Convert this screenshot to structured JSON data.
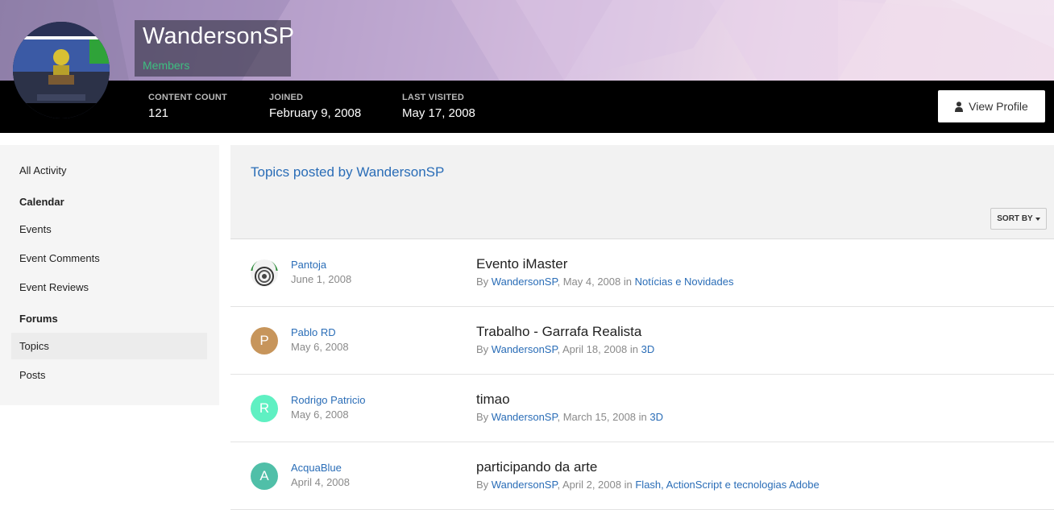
{
  "profile": {
    "username": "WandersonSP",
    "group": "Members",
    "stats": [
      {
        "label": "CONTENT COUNT",
        "value": "121"
      },
      {
        "label": "JOINED",
        "value": "February 9, 2008"
      },
      {
        "label": "LAST VISITED",
        "value": "May 17, 2008"
      }
    ],
    "view_profile_label": "View Profile"
  },
  "sidebar": {
    "all_activity": "All Activity",
    "calendar_heading": "Calendar",
    "calendar_items": [
      "Events",
      "Event Comments",
      "Event Reviews"
    ],
    "forums_heading": "Forums",
    "forums_items": [
      "Topics",
      "Posts"
    ]
  },
  "main": {
    "title": "Topics posted by WandersonSP",
    "sort_label": "SORT BY",
    "by_label": "By",
    "in_label": "in",
    "topics": [
      {
        "poster": "Pantoja",
        "poster_date": "June 1, 2008",
        "avatar_letter": "",
        "avatar_color": "#ffffff",
        "title": "Evento iMaster",
        "author": "WandersonSP",
        "date": "May 4, 2008",
        "forum": "Notícias e Novidades"
      },
      {
        "poster": "Pablo RD",
        "poster_date": "May 6, 2008",
        "avatar_letter": "P",
        "avatar_color": "#c7955b",
        "title": "Trabalho - Garrafa Realista",
        "author": "WandersonSP",
        "date": "April 18, 2008",
        "forum": "3D"
      },
      {
        "poster": "Rodrigo Patricio",
        "poster_date": "May 6, 2008",
        "avatar_letter": "R",
        "avatar_color": "#5ff0c2",
        "title": "timao",
        "author": "WandersonSP",
        "date": "March 15, 2008",
        "forum": "3D"
      },
      {
        "poster": "AcquaBlue",
        "poster_date": "April 4, 2008",
        "avatar_letter": "A",
        "avatar_color": "#50bfa8",
        "title": "participando da arte",
        "author": "WandersonSP",
        "date": "April 2, 2008",
        "forum": "Flash, ActionScript e tecnologias Adobe"
      }
    ]
  },
  "colors": {
    "link": "#2a6db7",
    "group": "#3dbf80",
    "header_bar": "#000000"
  },
  "icons": {
    "view_profile": "user-icon",
    "sort": "caret-down-icon"
  }
}
